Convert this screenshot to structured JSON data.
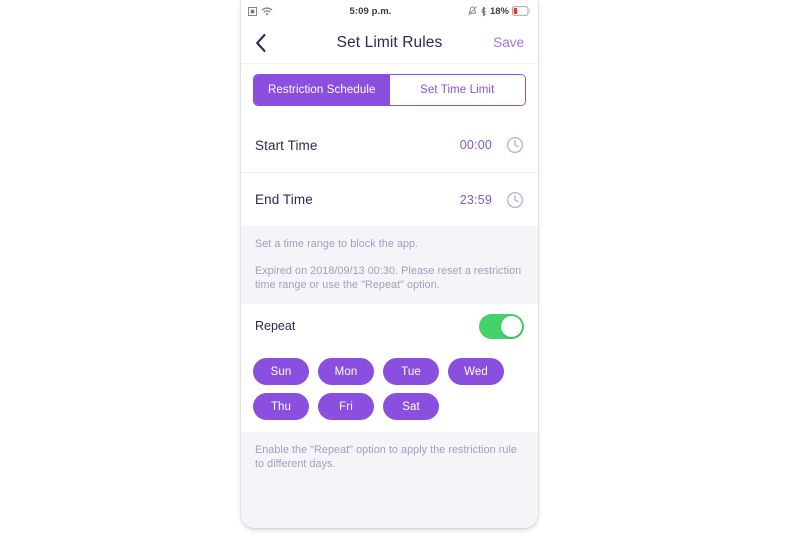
{
  "status_bar": {
    "left_icons": [
      "sim-card-icon",
      "wifi-icon"
    ],
    "time": "5:09 p.m.",
    "right_icons": [
      "mute-bell-icon",
      "bluetooth-icon"
    ],
    "battery_percent": "18%",
    "battery_icon": "battery-low-icon"
  },
  "header": {
    "back_icon": "chevron-left-icon",
    "title": "Set Limit Rules",
    "save_label": "Save"
  },
  "segmented": {
    "tabs": [
      {
        "label": "Restriction Schedule",
        "active": true
      },
      {
        "label": "Set Time Limit",
        "active": false
      }
    ]
  },
  "time_rows": [
    {
      "label": "Start Time",
      "value": "00:00",
      "icon": "clock-icon"
    },
    {
      "label": "End Time",
      "value": "23:59",
      "icon": "clock-icon"
    }
  ],
  "info_top": {
    "line1": "Set a time range to block the app.",
    "line2": "Expired on 2018/09/13 00:30. Please reset a restriction time range or use the \"Repeat\" option."
  },
  "repeat": {
    "label": "Repeat",
    "enabled": true,
    "toggle_on_color": "#45d268"
  },
  "days": {
    "row1": [
      {
        "label": "Sun",
        "selected": true
      },
      {
        "label": "Mon",
        "selected": true
      },
      {
        "label": "Tue",
        "selected": true
      },
      {
        "label": "Wed",
        "selected": true
      }
    ],
    "row2": [
      {
        "label": "Thu",
        "selected": true
      },
      {
        "label": "Fri",
        "selected": true
      },
      {
        "label": "Sat",
        "selected": true
      }
    ]
  },
  "info_bottom": {
    "line1": "Enable the \"Repeat\" option to apply the restriction rule to different days."
  },
  "colors": {
    "accent_purple": "#8a4fdf",
    "value_purple": "#8257cf",
    "title_navy": "#2d2a52",
    "muted_purple": "#a49dc0",
    "toggle_green": "#45d268",
    "section_gray": "#f5f4f8"
  }
}
